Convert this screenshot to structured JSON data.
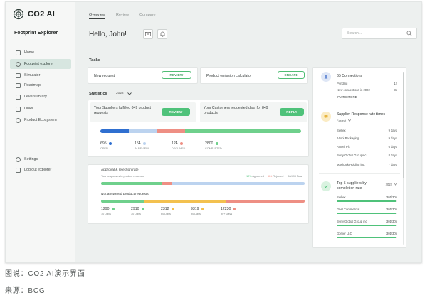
{
  "app": {
    "name": "CO2 AI"
  },
  "sidebar": {
    "title": "Footprint Explorer",
    "items": [
      {
        "label": "Home",
        "icon": "home-icon"
      },
      {
        "label": "Footprint explorer",
        "icon": "globe-icon",
        "active": true
      },
      {
        "label": "Simulator",
        "icon": "simulator-icon"
      },
      {
        "label": "Roadmap",
        "icon": "roadmap-icon"
      },
      {
        "label": "Levers library",
        "icon": "library-icon"
      },
      {
        "label": "Links",
        "icon": "link-icon"
      },
      {
        "label": "Product Ecosystem",
        "icon": "users-icon"
      }
    ],
    "bottom": [
      {
        "label": "Settings",
        "icon": "gear-icon"
      },
      {
        "label": "Log out explorer",
        "icon": "logout-icon"
      }
    ]
  },
  "topnav": {
    "tabs": [
      "Overview",
      "Review",
      "Compare"
    ],
    "active": 0
  },
  "greeting": "Hello, John!",
  "search": {
    "placeholder": "Search..."
  },
  "tasks": {
    "title": "Tasks",
    "items": [
      {
        "label": "New request",
        "button": "REVIEW"
      },
      {
        "label": "Product emission calculator",
        "button": "CREATE"
      }
    ]
  },
  "statistics": {
    "title": "Statistics",
    "year": "2022",
    "card1": {
      "text": "Your Suppliers fulfilled 849 product requests",
      "button": "REVIEW"
    },
    "card2": {
      "text": "Your Customers requested data for 849 products",
      "button": "REPLY"
    },
    "status_counts": [
      {
        "value": 695,
        "label": "OPEN",
        "color": "#2f6fd0"
      },
      {
        "value": 154,
        "label": "IN REVIEW",
        "color": "#bcd3ef"
      },
      {
        "value": 124,
        "label": "DECLINED",
        "color": "#ee8f84"
      },
      {
        "value": 2800,
        "label": "COMPLETED",
        "color": "#6fd08c"
      }
    ]
  },
  "approval": {
    "title": "Approval & rejection rate",
    "subtitle": "Your responses to product requests",
    "legend": [
      {
        "label": "Approved",
        "pct": "10%",
        "color": "#6fd08c"
      },
      {
        "label": "Rejected",
        "pct": "8%",
        "color": "#ee8f84"
      },
      {
        "label": "50/899 Total"
      }
    ],
    "bar_fractions": {
      "approved": 0.3,
      "rejected": 0.05,
      "pending": 0.65
    }
  },
  "not_answered": {
    "title": "Not answered product requests",
    "buckets": [
      {
        "value": "1290",
        "label": "10 Days",
        "color": "#6fd08c"
      },
      {
        "value": "2910",
        "label": "30 Days",
        "color": "#6fd08c"
      },
      {
        "value": "2312",
        "label": "60 Days",
        "color": "#f3c14f"
      },
      {
        "value": "9319",
        "label": "90 Days",
        "color": "#f3c14f"
      },
      {
        "value": "12230",
        "label": "90+ Days",
        "color": "#ee8f84"
      }
    ]
  },
  "right_panel": {
    "connections": {
      "title": "65 Connections",
      "rows": [
        {
          "label": "Pending",
          "value": "12"
        },
        {
          "label": "New connections in 2022",
          "value": "35"
        }
      ],
      "link": "INVITE MORE"
    },
    "response_time": {
      "title": "Supplier Response rate times",
      "filter": "Fastest",
      "rows": [
        {
          "label": "Stellex",
          "value": "9 days"
        },
        {
          "label": "Altoni Packaging",
          "value": "9 days"
        },
        {
          "label": "Antoni Plc",
          "value": "6 days"
        },
        {
          "label": "Berry Global Groupinc",
          "value": "8 days"
        },
        {
          "label": "Mushpak Holding inc.",
          "value": "7 days"
        }
      ]
    },
    "top_suppliers": {
      "title": "Top 5 suppliers by completion rate",
      "year": "2022",
      "rows": [
        {
          "label": "Stellex",
          "value": "301/305"
        },
        {
          "label": "Gael Commercial",
          "value": "301/305"
        },
        {
          "label": "Berry Global Group inc",
          "value": "301/305"
        },
        {
          "label": "Gomer LLC",
          "value": "301/305"
        }
      ]
    }
  },
  "caption": {
    "line1": "图说：CO2 AI演示界面",
    "line2": "来源：BCG"
  },
  "colors": {
    "accent": "#4fc27a",
    "active_bg": "#d7e6e0"
  }
}
